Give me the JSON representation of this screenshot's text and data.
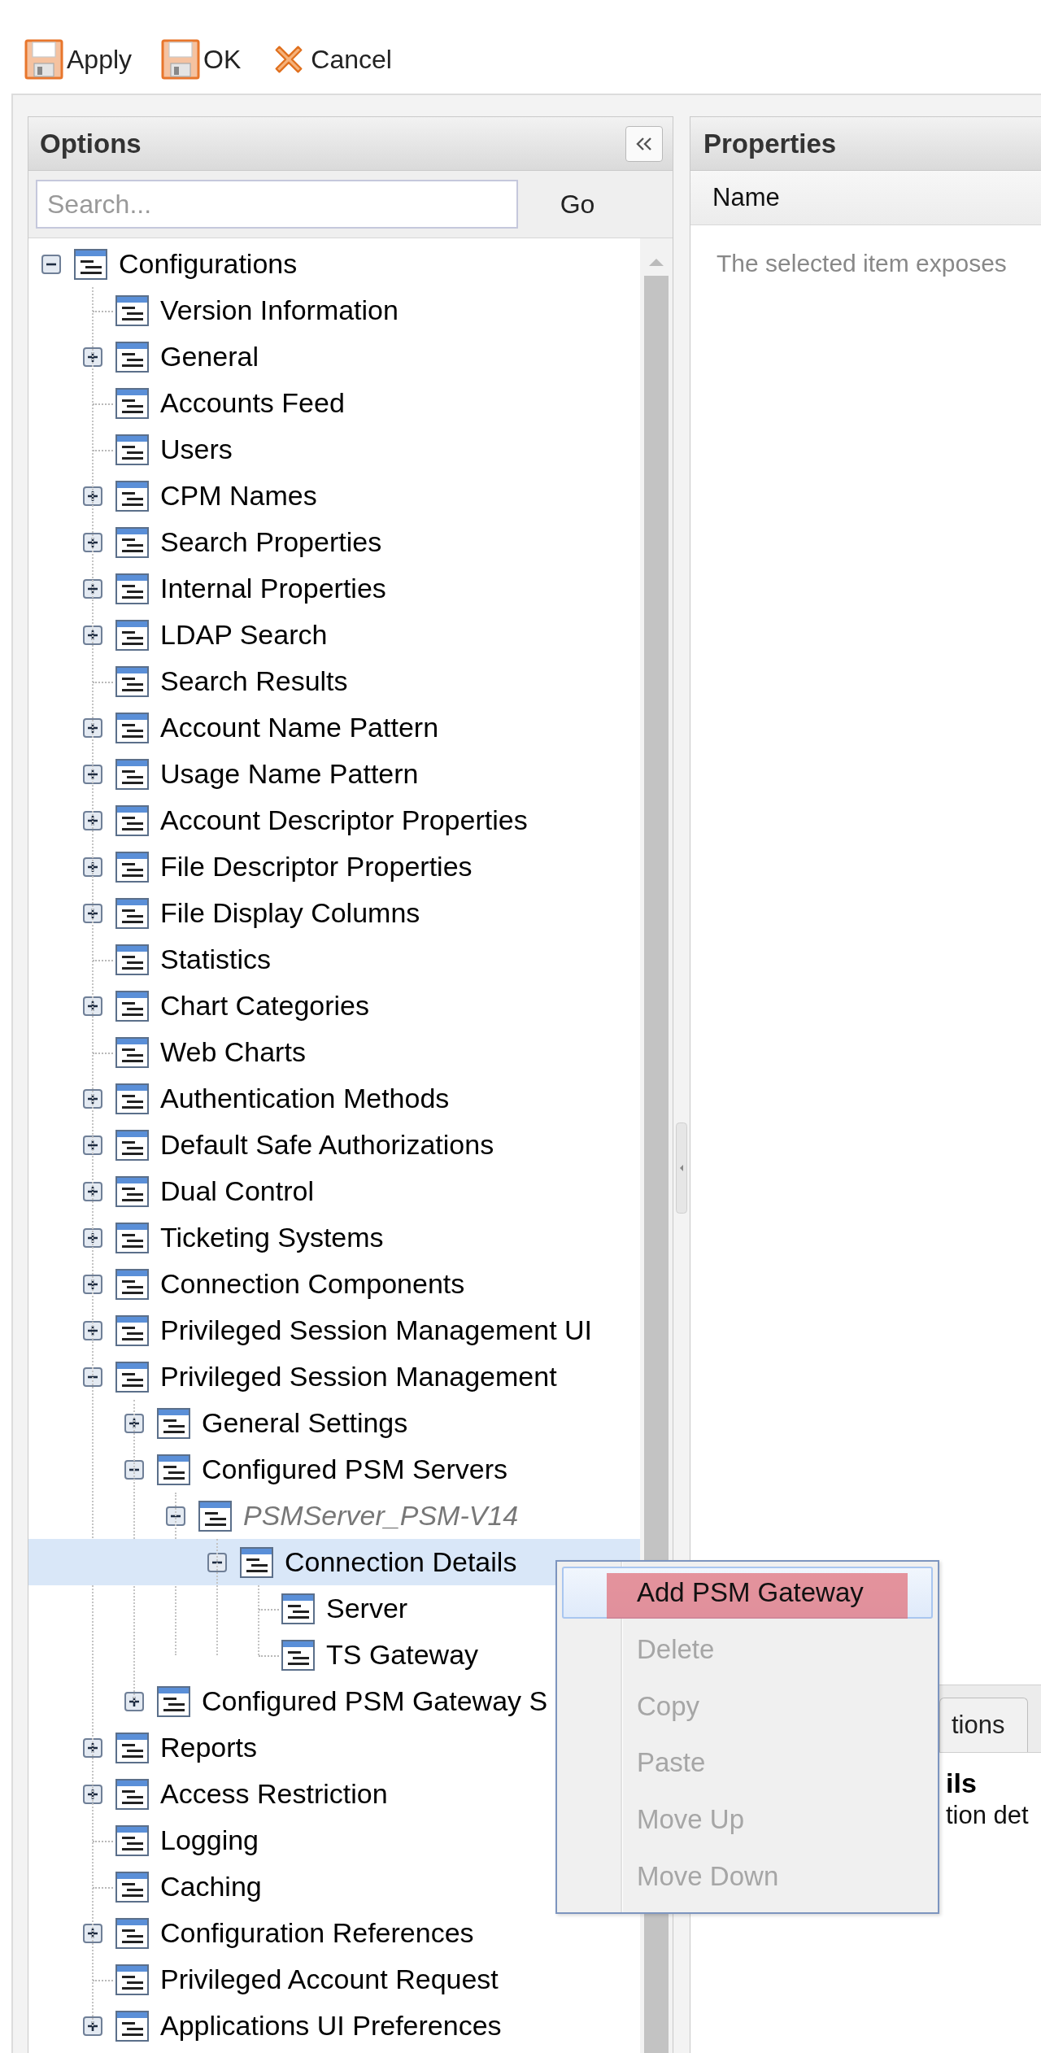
{
  "toolbar": [
    {
      "label": "Apply",
      "kind": "save"
    },
    {
      "label": "OK",
      "kind": "save"
    },
    {
      "label": "Cancel",
      "kind": "cancel"
    }
  ],
  "options": {
    "title": "Options",
    "search": {
      "placeholder": "Search...",
      "button": "Go"
    },
    "tree": [
      {
        "label": "Configurations",
        "expanded": true,
        "selected": false,
        "children": [
          {
            "label": "Version Information",
            "selected": false
          },
          {
            "label": "General",
            "expanded": false,
            "selected": false
          },
          {
            "label": "Accounts Feed",
            "selected": false
          },
          {
            "label": "Users",
            "selected": false
          },
          {
            "label": "CPM Names",
            "expanded": false,
            "selected": false
          },
          {
            "label": "Search Properties",
            "expanded": false,
            "selected": false
          },
          {
            "label": "Internal Properties",
            "expanded": false,
            "selected": false
          },
          {
            "label": "LDAP Search",
            "expanded": false,
            "selected": false
          },
          {
            "label": "Search Results",
            "selected": false
          },
          {
            "label": "Account Name Pattern",
            "expanded": false,
            "selected": false
          },
          {
            "label": "Usage Name Pattern",
            "expanded": false,
            "selected": false
          },
          {
            "label": "Account Descriptor Properties",
            "expanded": false,
            "selected": false
          },
          {
            "label": "File Descriptor Properties",
            "expanded": false,
            "selected": false
          },
          {
            "label": "File Display Columns",
            "expanded": false,
            "selected": false
          },
          {
            "label": "Statistics",
            "selected": false
          },
          {
            "label": "Chart Categories",
            "expanded": false,
            "selected": false
          },
          {
            "label": "Web Charts",
            "selected": false
          },
          {
            "label": "Authentication Methods",
            "expanded": false,
            "selected": false
          },
          {
            "label": "Default Safe Authorizations",
            "expanded": false,
            "selected": false
          },
          {
            "label": "Dual Control",
            "expanded": false,
            "selected": false
          },
          {
            "label": "Ticketing Systems",
            "expanded": false,
            "selected": false
          },
          {
            "label": "Connection Components",
            "expanded": false,
            "selected": false
          },
          {
            "label": "Privileged Session Management UI",
            "expanded": false,
            "selected": false
          },
          {
            "label": "Privileged Session Management",
            "expanded": true,
            "selected": false,
            "children": [
              {
                "label": "General Settings",
                "expanded": false,
                "selected": false
              },
              {
                "label": "Configured PSM Servers",
                "expanded": true,
                "selected": false,
                "children": [
                  {
                    "label": "PSMServer_PSM-V14",
                    "kind": "instance",
                    "expanded": true,
                    "selected": false,
                    "children": [
                      {
                        "label": "Connection Details",
                        "expanded": true,
                        "selected": true,
                        "children": [
                          {
                            "label": "Server",
                            "selected": false
                          },
                          {
                            "label": "TS Gateway",
                            "selected": false
                          }
                        ]
                      }
                    ]
                  }
                ]
              },
              {
                "label": "Configured PSM Gateway S",
                "expanded": false,
                "selected": false
              }
            ]
          },
          {
            "label": "Reports",
            "expanded": false,
            "selected": false
          },
          {
            "label": "Access Restriction",
            "expanded": false,
            "selected": false
          },
          {
            "label": "Logging",
            "selected": false
          },
          {
            "label": "Caching",
            "selected": false
          },
          {
            "label": "Configuration References",
            "expanded": false,
            "selected": false
          },
          {
            "label": "Privileged Account Request",
            "selected": false
          },
          {
            "label": "Applications UI Preferences",
            "expanded": false,
            "selected": false
          }
        ]
      }
    ]
  },
  "properties": {
    "title": "Properties",
    "columns": [
      "Name"
    ],
    "empty_message": "The selected item exposes",
    "tabs": [
      {
        "label": "tions"
      }
    ],
    "details": {
      "title": "ils",
      "description": "tion det"
    }
  },
  "context_menu": [
    {
      "label": "Add PSM Gateway",
      "selected": true,
      "disabled": false,
      "marked": true
    },
    {
      "label": "Delete",
      "selected": false,
      "disabled": true,
      "marked": false
    },
    {
      "label": "Copy",
      "selected": false,
      "disabled": true,
      "marked": false
    },
    {
      "label": "Paste",
      "selected": false,
      "disabled": true,
      "marked": false
    },
    {
      "label": "Move Up",
      "selected": false,
      "disabled": true,
      "marked": false
    },
    {
      "label": "Move Down",
      "selected": false,
      "disabled": true,
      "marked": false
    }
  ]
}
